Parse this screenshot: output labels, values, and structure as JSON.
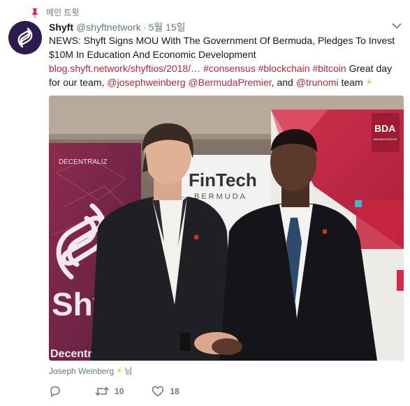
{
  "pinned_label": "메인 트윗",
  "author": {
    "name": "Shyft",
    "handle": "@shyftnetwork",
    "separator": "·",
    "date": "5월 15일"
  },
  "tweet": {
    "headline": "NEWS: Shyft Signs MOU With The Government Of Bermuda, Pledges To Invest $10M In Education And Economic Development",
    "url": "blog.shyft.network/shyftios/2018/…",
    "hashtags": [
      "#consensus",
      "#blockchain",
      "#bitcoin"
    ],
    "text_mid": "Great day for our team,",
    "mentions": [
      "@josephweinberg",
      "@BermudaPremier"
    ],
    "text_and": ", and",
    "mention_last": "@trunomi",
    "text_end": "team",
    "emoji": "⚡"
  },
  "photo": {
    "banner_left_brand": "Shyft",
    "banner_left_sub": "Decentraliz",
    "banner_left_top": "DECENTRALIZ",
    "banner_center_title": "FinTech",
    "banner_center_sub": "BERMUDA",
    "banner_right_logo": "BDA",
    "banner_right_logo_sub": "BERMUDA BUSINESS DEVELOPMENT AGENCY"
  },
  "caption": {
    "user": "Joseph Weinberg",
    "emoji": "⚡",
    "suffix": "님"
  },
  "actions": {
    "retweet_count": "10",
    "like_count": "18"
  },
  "colors": {
    "link": "#ad2b3b",
    "avatar_bg": "#2b1b4f",
    "emoji": "#f5a623",
    "meta": "#657786"
  }
}
